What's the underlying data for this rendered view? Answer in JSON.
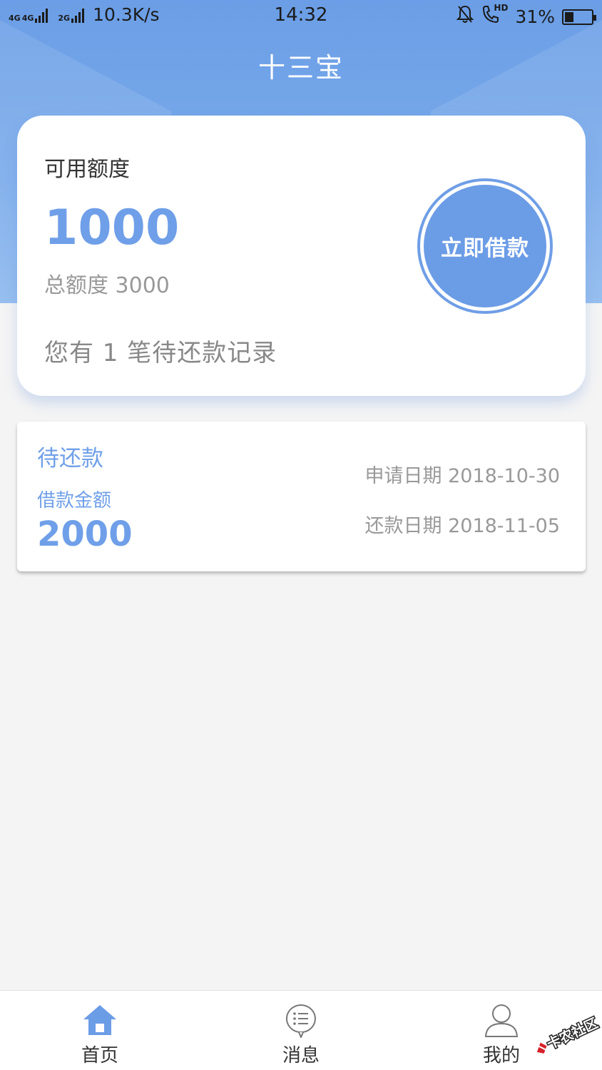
{
  "status_bar": {
    "network_1": "4G",
    "network_2": "4G",
    "network_3": "2G",
    "speed": "10.3K/s",
    "time": "14:32",
    "hd_label": "HD",
    "battery": "31%"
  },
  "header": {
    "title": "十三宝"
  },
  "credit": {
    "label": "可用额度",
    "amount": "1000",
    "total": "总额度 3000",
    "pending_note": "您有 1 笔待还款记录",
    "borrow_button": "立即借款"
  },
  "loan": {
    "status": "待还款",
    "amount_label": "借款金额",
    "amount": "2000",
    "apply_date": "申请日期 2018-10-30",
    "due_date": "还款日期 2018-11-05"
  },
  "tabs": [
    {
      "label": "首页",
      "icon": "home-icon",
      "active": true
    },
    {
      "label": "消息",
      "icon": "message-icon",
      "active": false
    },
    {
      "label": "我的",
      "icon": "user-icon",
      "active": false
    }
  ],
  "watermark_text": "卡农社区",
  "colors": {
    "accent": "#6f9fe8",
    "header": "#6b9ee6",
    "background": "#f4f4f4"
  }
}
